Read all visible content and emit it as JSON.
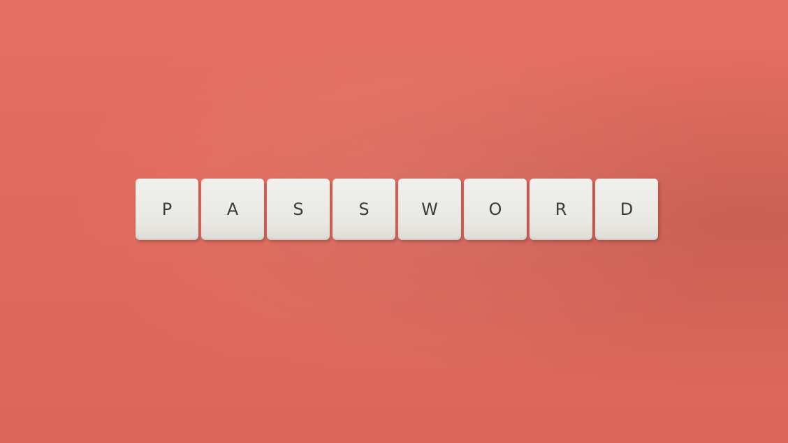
{
  "photo": {
    "background_color": "#e06a5d",
    "tile_color": "#eceae5",
    "letter_color": "#3b3b3b",
    "tiles": [
      "P",
      "A",
      "S",
      "S",
      "W",
      "O",
      "R",
      "D"
    ]
  }
}
